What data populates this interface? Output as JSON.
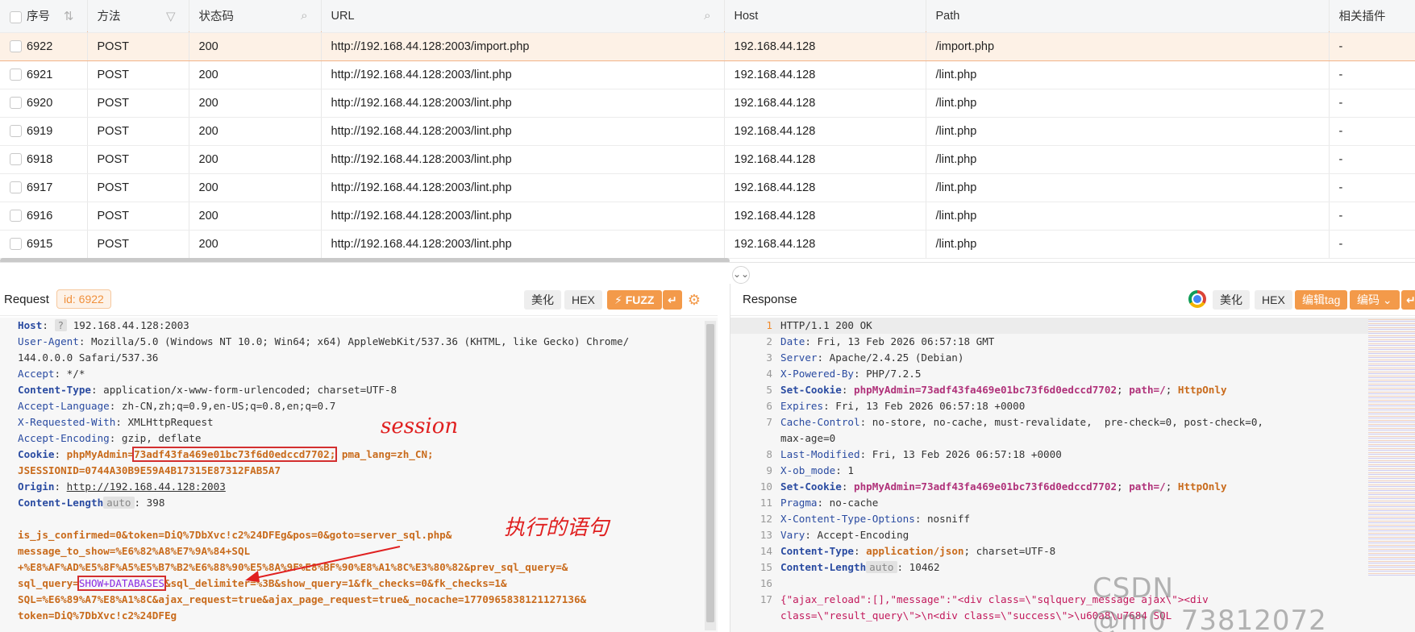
{
  "table": {
    "columns": [
      "序号",
      "方法",
      "状态码",
      "URL",
      "Host",
      "Path",
      "相关插件"
    ],
    "rows": [
      {
        "id": "6922",
        "method": "POST",
        "status": "200",
        "url": "http://192.168.44.128:2003/import.php",
        "host": "192.168.44.128",
        "path": "/import.php",
        "plugin": "-"
      },
      {
        "id": "6921",
        "method": "POST",
        "status": "200",
        "url": "http://192.168.44.128:2003/lint.php",
        "host": "192.168.44.128",
        "path": "/lint.php",
        "plugin": "-"
      },
      {
        "id": "6920",
        "method": "POST",
        "status": "200",
        "url": "http://192.168.44.128:2003/lint.php",
        "host": "192.168.44.128",
        "path": "/lint.php",
        "plugin": "-"
      },
      {
        "id": "6919",
        "method": "POST",
        "status": "200",
        "url": "http://192.168.44.128:2003/lint.php",
        "host": "192.168.44.128",
        "path": "/lint.php",
        "plugin": "-"
      },
      {
        "id": "6918",
        "method": "POST",
        "status": "200",
        "url": "http://192.168.44.128:2003/lint.php",
        "host": "192.168.44.128",
        "path": "/lint.php",
        "plugin": "-"
      },
      {
        "id": "6917",
        "method": "POST",
        "status": "200",
        "url": "http://192.168.44.128:2003/lint.php",
        "host": "192.168.44.128",
        "path": "/lint.php",
        "plugin": "-"
      },
      {
        "id": "6916",
        "method": "POST",
        "status": "200",
        "url": "http://192.168.44.128:2003/lint.php",
        "host": "192.168.44.128",
        "path": "/lint.php",
        "plugin": "-"
      },
      {
        "id": "6915",
        "method": "POST",
        "status": "200",
        "url": "http://192.168.44.128:2003/lint.php",
        "host": "192.168.44.128",
        "path": "/lint.php",
        "plugin": "-"
      }
    ],
    "selected_index": 0
  },
  "request": {
    "title": "Request",
    "id_badge": "id: 6922",
    "buttons": {
      "beautify": "美化",
      "hex": "HEX",
      "fuzz": "⚡ FUZZ"
    },
    "lines": [
      [
        "Host",
        ": ",
        "?",
        " 192.168.44.128:2003"
      ],
      [
        "User-Agent",
        ": Mozilla/5.0 (Windows NT 10.0; Win64; x64) AppleWebKit/537.36 (KHTML, like Gecko) Chrome/"
      ],
      [
        "",
        "144.0.0.0 Safari/537.36"
      ],
      [
        "Accept",
        ": */*"
      ],
      [
        "Content-Type",
        ": ",
        "application/x-www-form-urlencoded",
        "; charset=UTF-8"
      ],
      [
        "Accept-Language",
        ": zh-CN,zh;q=0.9,en-US;q=0.8,en;q=0.7"
      ],
      [
        "X-Requested-With",
        ": XMLHttpRequest"
      ],
      [
        "Accept-Encoding",
        ": gzip, deflate"
      ],
      [
        "Cookie",
        ": ",
        "phpMyAdmin=",
        "73adf43fa469e01bc73f6d0edccd7702;",
        " pma_lang=zh_CN;"
      ],
      [
        "",
        "JSESSIONID=0744A30B9E59A4B17315E87312FAB5A7"
      ],
      [
        "Origin",
        ": ",
        "http://192.168.44.128:2003"
      ],
      [
        "Content-Length",
        "auto",
        ": 398"
      ],
      [
        "",
        ""
      ],
      [
        "",
        "is_js_confirmed=0&token=DiQ%7DbXvc!c2%24DFEg&pos=0&goto=server_sql.php&"
      ],
      [
        "",
        "message_to_show=%E6%82%A8%E7%9A%84+SQL"
      ],
      [
        "",
        "+%E8%AF%AD%E5%8F%A5%E5%B7%B2%E6%88%90%E5%8A%9F%E8%BF%90%E8%A1%8C%E3%80%82&prev_sql_query=&"
      ],
      [
        "",
        "sql_query=",
        "SHOW+DATABASES",
        "&sql_delimiter=%3B&show_query=1&fk_checks=0&fk_checks=1&"
      ],
      [
        "",
        "SQL=%E6%89%A7%E8%A1%8C&ajax_request=true&ajax_page_request=true&_nocache=1770965838121127136&"
      ],
      [
        "",
        "token=DiQ%7DbXvc!c2%24DFEg"
      ]
    ],
    "annotations": {
      "session": "session",
      "statement": "执行的语句"
    }
  },
  "response": {
    "title": "Response",
    "buttons": {
      "beautify": "美化",
      "hex": "HEX",
      "edit_tag": "编辑tag",
      "encoding": "编码 ⌄"
    },
    "lines": [
      [
        "1",
        "HTTP/1.1 200 OK"
      ],
      [
        "2",
        "Date",
        ": Fri, 13 Feb 2026 06:57:18 GMT"
      ],
      [
        "3",
        "Server",
        ": Apache/2.4.25 (Debian)"
      ],
      [
        "4",
        "X-Powered-By",
        ": PHP/7.2.5"
      ],
      [
        "5",
        "Set-Cookie",
        ": ",
        "phpMyAdmin=73adf43fa469e01bc73f6d0edccd7702",
        "; ",
        "path=/",
        "; ",
        "HttpOnly"
      ],
      [
        "6",
        "Expires",
        ": Fri, 13 Feb 2026 06:57:18 +0000"
      ],
      [
        "7",
        "Cache-Control",
        ": no-store, no-cache, must-revalidate,  pre-check=0, post-check=0,"
      ],
      [
        "",
        "",
        "max-age=0"
      ],
      [
        "8",
        "Last-Modified",
        ": Fri, 13 Feb 2026 06:57:18 +0000"
      ],
      [
        "9",
        "X-ob_mode",
        ": 1"
      ],
      [
        "10",
        "Set-Cookie",
        ": ",
        "phpMyAdmin=73adf43fa469e01bc73f6d0edccd7702",
        "; ",
        "path=/",
        "; ",
        "HttpOnly"
      ],
      [
        "11",
        "Pragma",
        ": no-cache"
      ],
      [
        "12",
        "X-Content-Type-Options",
        ": nosniff"
      ],
      [
        "13",
        "Vary",
        ": Accept-Encoding"
      ],
      [
        "14",
        "Content-Type",
        ": ",
        "application/json",
        "; charset=UTF-8"
      ],
      [
        "15",
        "Content-Length",
        "auto",
        ": 10462"
      ],
      [
        "16",
        ""
      ],
      [
        "17",
        "{\"ajax_reload\":[],\"message\":\"<div class=\\\"sqlquery_message ajax\\\"><div"
      ],
      [
        "",
        "class=\\\"result_query\\\">\\n<div class=\\\"success\\\">\\u60a8\\u7684 SQL"
      ]
    ]
  },
  "watermark": "CSDN @m0_73812072"
}
